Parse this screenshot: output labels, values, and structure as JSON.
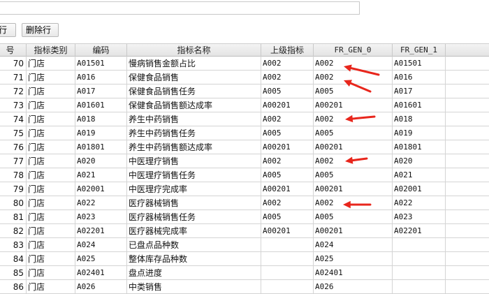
{
  "toolbar": {
    "add_row_label": "行",
    "delete_row_label": "删除行"
  },
  "table": {
    "columns": [
      "号",
      "指标类别",
      "编码",
      "指标名称",
      "上级指标",
      "FR_GEN_0",
      "FR_GEN_1"
    ],
    "rows": [
      [
        "70",
        "门店",
        "A01501",
        "慢病销售金额占比",
        "A002",
        "A002",
        "A01501"
      ],
      [
        "71",
        "门店",
        "A016",
        "保健食品销售",
        "A002",
        "A002",
        "A016"
      ],
      [
        "72",
        "门店",
        "A017",
        "保健食品销售任务",
        "A005",
        "A005",
        "A017"
      ],
      [
        "73",
        "门店",
        "A01601",
        "保健食品销售额达成率",
        "A00201",
        "A00201",
        "A01601"
      ],
      [
        "74",
        "门店",
        "A018",
        "养生中药销售",
        "A002",
        "A002",
        "A018"
      ],
      [
        "75",
        "门店",
        "A019",
        "养生中药销售任务",
        "A005",
        "A005",
        "A019"
      ],
      [
        "76",
        "门店",
        "A01801",
        "养生中药销售额达成率",
        "A00201",
        "A00201",
        "A01801"
      ],
      [
        "77",
        "门店",
        "A020",
        "中医理疗销售",
        "A002",
        "A002",
        "A020"
      ],
      [
        "78",
        "门店",
        "A021",
        "中医理疗销售任务",
        "A005",
        "A005",
        "A021"
      ],
      [
        "79",
        "门店",
        "A02001",
        "中医理疗完成率",
        "A00201",
        "A00201",
        "A02001"
      ],
      [
        "80",
        "门店",
        "A022",
        "医疗器械销售",
        "A002",
        "A002",
        "A022"
      ],
      [
        "81",
        "门店",
        "A023",
        "医疗器械销售任务",
        "A005",
        "A005",
        "A023"
      ],
      [
        "82",
        "门店",
        "A02201",
        "医疗器械完成率",
        "A00201",
        "A00201",
        "A02201"
      ],
      [
        "83",
        "门店",
        "A024",
        "已盘点品种数",
        "",
        "A024",
        ""
      ],
      [
        "84",
        "门店",
        "A025",
        "整体库存品种数",
        "",
        "A025",
        ""
      ],
      [
        "85",
        "门店",
        "A02401",
        "盘点进度",
        "",
        "A02401",
        ""
      ],
      [
        "86",
        "门店",
        "A026",
        "中类销售",
        "",
        "A026",
        ""
      ]
    ]
  },
  "annotations": {
    "arrow_color": "#e8261c",
    "arrow_rows": [
      "70",
      "71",
      "74",
      "77",
      "80"
    ]
  }
}
